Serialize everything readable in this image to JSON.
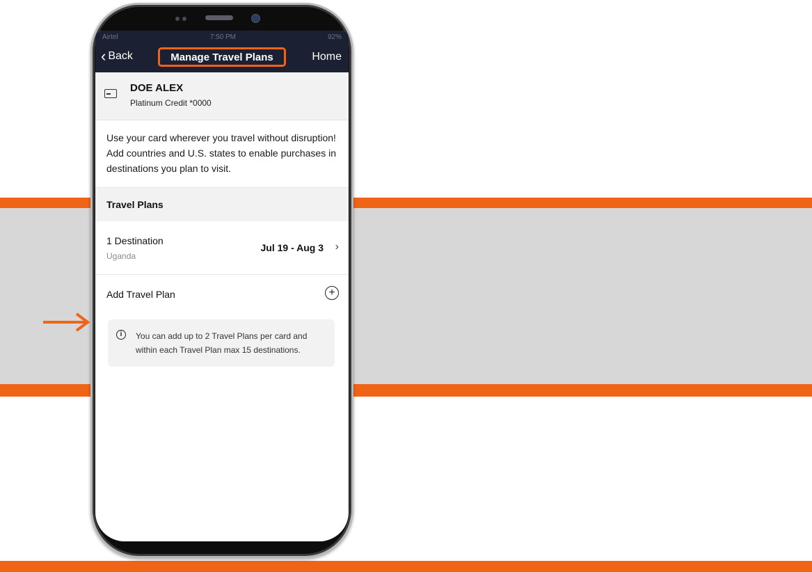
{
  "colors": {
    "accent": "#f06417",
    "navbar": "#1b2132",
    "band": "#d7d7d7"
  },
  "statusbar": {
    "carrier": "Airtel",
    "time": "7:50 PM",
    "battery": "92%"
  },
  "navbar": {
    "back_label": "Back",
    "title": "Manage Travel Plans",
    "home_label": "Home"
  },
  "card": {
    "icon": "credit-card-icon",
    "name": "DOE ALEX",
    "type": "Platinum Credit *0000"
  },
  "intro_text": "Use your card wherever you travel without disruption! Add countries and U.S. states to enable purchases in destinations you plan to visit.",
  "section_title": "Travel Plans",
  "plans": [
    {
      "title": "1 Destination",
      "subtitle": "Uganda",
      "dates": "Jul 19 - Aug 3"
    }
  ],
  "add_plan": {
    "label": "Add Travel Plan",
    "icon": "plus-circle-icon"
  },
  "note": {
    "icon": "info-icon",
    "text": "You can add up to 2 Travel Plans per card and within each Travel Plan max 15 destinations."
  }
}
